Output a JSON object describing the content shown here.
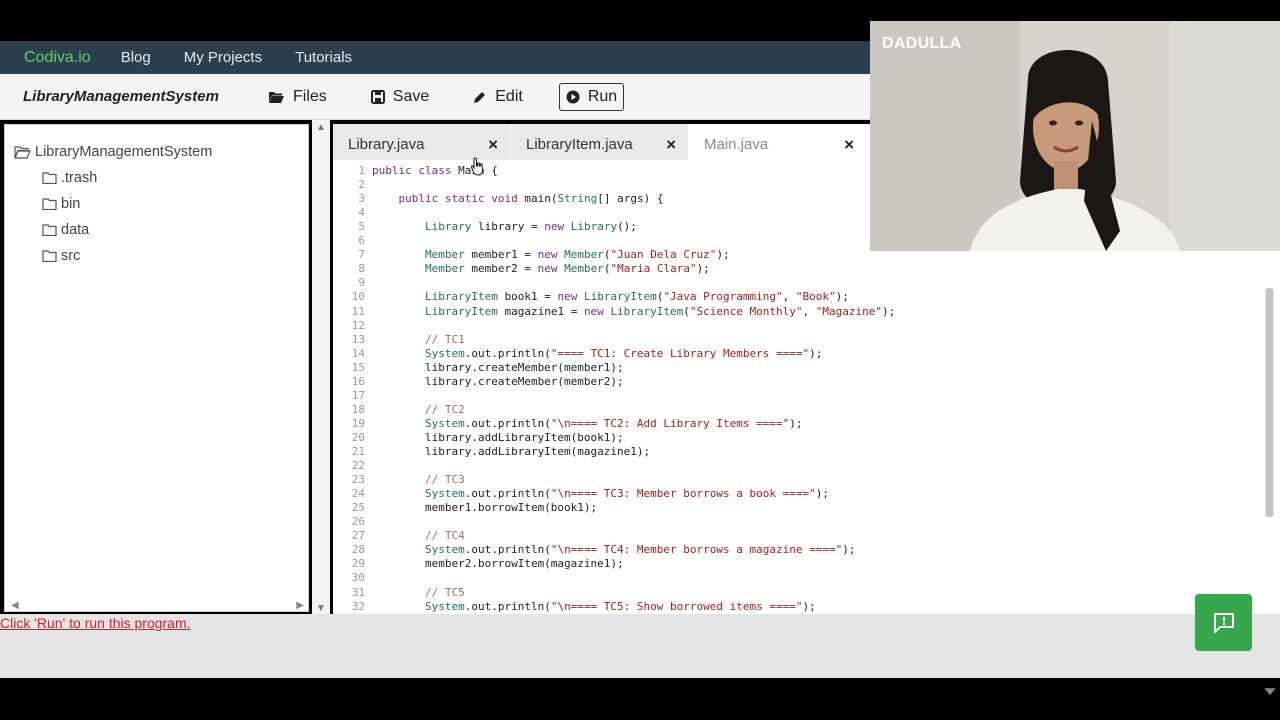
{
  "nav": {
    "brand": "Codiva.io",
    "items": [
      "Blog",
      "My Projects",
      "Tutorials"
    ]
  },
  "toolbar": {
    "project_name": "LibraryManagementSystem",
    "files_label": "Files",
    "save_label": "Save",
    "edit_label": "Edit",
    "run_label": "Run"
  },
  "tree": {
    "root": "LibraryManagementSystem",
    "children": [
      ".trash",
      "bin",
      "data",
      "src"
    ]
  },
  "tabs": [
    {
      "label": "Library.java",
      "close": "×",
      "active": false
    },
    {
      "label": "LibraryItem.java",
      "close": "×",
      "active": false
    },
    {
      "label": "Main.java",
      "close": "×",
      "active": true
    }
  ],
  "code_lines": [
    {
      "n": "1",
      "text": "public class Main {"
    },
    {
      "n": "2",
      "text": ""
    },
    {
      "n": "3",
      "text": "    public static void main(String[] args) {"
    },
    {
      "n": "4",
      "text": ""
    },
    {
      "n": "5",
      "text": "        Library library = new Library();"
    },
    {
      "n": "6",
      "text": ""
    },
    {
      "n": "7",
      "text": "        Member member1 = new Member(\"Juan Dela Cruz\");"
    },
    {
      "n": "8",
      "text": "        Member member2 = new Member(\"Maria Clara\");"
    },
    {
      "n": "9",
      "text": ""
    },
    {
      "n": "10",
      "text": "        LibraryItem book1 = new LibraryItem(\"Java Programming\", \"Book\");"
    },
    {
      "n": "11",
      "text": "        LibraryItem magazine1 = new LibraryItem(\"Science Monthly\", \"Magazine\");"
    },
    {
      "n": "12",
      "text": ""
    },
    {
      "n": "13",
      "text": "        // TC1"
    },
    {
      "n": "14",
      "text": "        System.out.println(\"==== TC1: Create Library Members ====\");"
    },
    {
      "n": "15",
      "text": "        library.createMember(member1);"
    },
    {
      "n": "16",
      "text": "        library.createMember(member2);"
    },
    {
      "n": "17",
      "text": ""
    },
    {
      "n": "18",
      "text": "        // TC2"
    },
    {
      "n": "19",
      "text": "        System.out.println(\"\\n==== TC2: Add Library Items ====\");"
    },
    {
      "n": "20",
      "text": "        library.addLibraryItem(book1);"
    },
    {
      "n": "21",
      "text": "        library.addLibraryItem(magazine1);"
    },
    {
      "n": "22",
      "text": ""
    },
    {
      "n": "23",
      "text": "        // TC3"
    },
    {
      "n": "24",
      "text": "        System.out.println(\"\\n==== TC3: Member borrows a book ====\");"
    },
    {
      "n": "25",
      "text": "        member1.borrowItem(book1);"
    },
    {
      "n": "26",
      "text": ""
    },
    {
      "n": "27",
      "text": "        // TC4"
    },
    {
      "n": "28",
      "text": "        System.out.println(\"\\n==== TC4: Member borrows a magazine ====\");"
    },
    {
      "n": "29",
      "text": "        member2.borrowItem(magazine1);"
    },
    {
      "n": "30",
      "text": ""
    },
    {
      "n": "31",
      "text": "        // TC5"
    },
    {
      "n": "32",
      "text": "        System.out.println(\"\\n==== TC5: Show borrowed items ====\");"
    }
  ],
  "status": {
    "message": "Click 'Run' to run this program."
  },
  "webcam": {
    "name": "DADULLA"
  },
  "colors": {
    "brand": "#5fcf6a",
    "nav_bg": "#2b3f4d",
    "status_link": "#d1202a",
    "feedback": "#36a84b"
  },
  "icons": {
    "files": "folder-open-icon",
    "save": "floppy-disk-icon",
    "edit": "pencil-icon",
    "run": "play-circle-icon",
    "feedback": "message-alert-icon"
  }
}
